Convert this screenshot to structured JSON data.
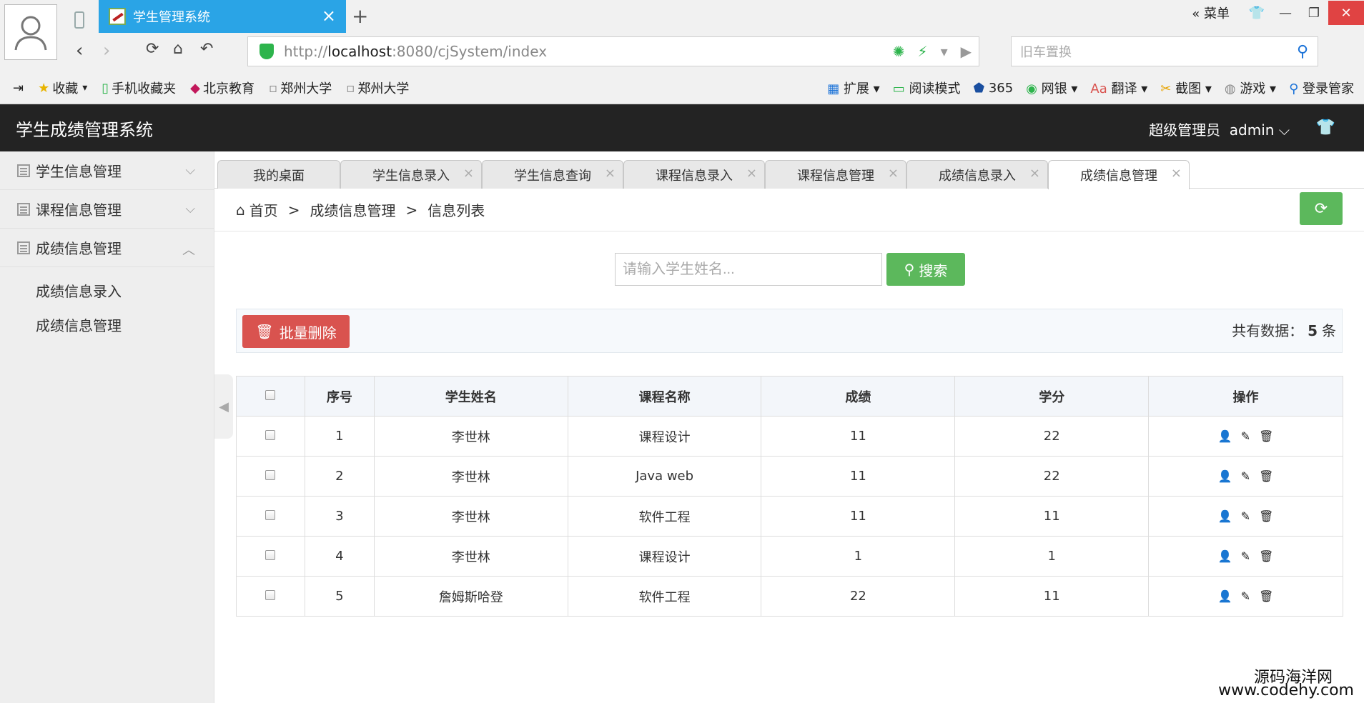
{
  "browser": {
    "tab_title": "学生管理系统",
    "menu_label": "菜单",
    "url_prefix": "http://",
    "url_host": "localhost",
    "url_rest": ":8080/cjSystem/index",
    "search_placeholder": "旧车置换",
    "bookmarks": [
      "收藏",
      "手机收藏夹",
      "北京教育",
      "郑州大学",
      "郑州大学"
    ],
    "tools": [
      "扩展",
      "阅读模式",
      "365",
      "网银",
      "翻译",
      "截图",
      "游戏",
      "登录管家"
    ]
  },
  "header": {
    "brand": "学生成绩管理系统",
    "user_role": "超级管理员",
    "user_name": "admin"
  },
  "sidebar": {
    "groups": [
      {
        "label": "学生信息管理"
      },
      {
        "label": "课程信息管理"
      },
      {
        "label": "成绩信息管理"
      }
    ],
    "subitems": [
      "成绩信息录入",
      "成绩信息管理"
    ]
  },
  "tabs": [
    {
      "label": "我的桌面"
    },
    {
      "label": "学生信息录入"
    },
    {
      "label": "学生信息查询"
    },
    {
      "label": "课程信息录入"
    },
    {
      "label": "课程信息管理"
    },
    {
      "label": "成绩信息录入"
    },
    {
      "label": "成绩信息管理"
    }
  ],
  "breadcrumb": {
    "home": "首页",
    "sep": ">",
    "level2": "成绩信息管理",
    "level3": "信息列表"
  },
  "search": {
    "placeholder": "请输入学生姓名...",
    "button": "搜索"
  },
  "toolbar": {
    "batch_delete": "批量删除",
    "count_prefix": "共有数据：",
    "count_value": "5",
    "count_suffix": "条"
  },
  "table": {
    "headers": [
      "序号",
      "学生姓名",
      "课程名称",
      "成绩",
      "学分",
      "操作"
    ],
    "rows": [
      [
        "1",
        "李世林",
        "课程设计",
        "11",
        "22"
      ],
      [
        "2",
        "李世林",
        "Java web",
        "11",
        "22"
      ],
      [
        "3",
        "李世林",
        "软件工程",
        "11",
        "11"
      ],
      [
        "4",
        "李世林",
        "课程设计",
        "1",
        "1"
      ],
      [
        "5",
        "詹姆斯哈登",
        "软件工程",
        "22",
        "11"
      ]
    ]
  },
  "watermark": {
    "line1": "源码海洋网",
    "line2": "www.codehy.com"
  }
}
